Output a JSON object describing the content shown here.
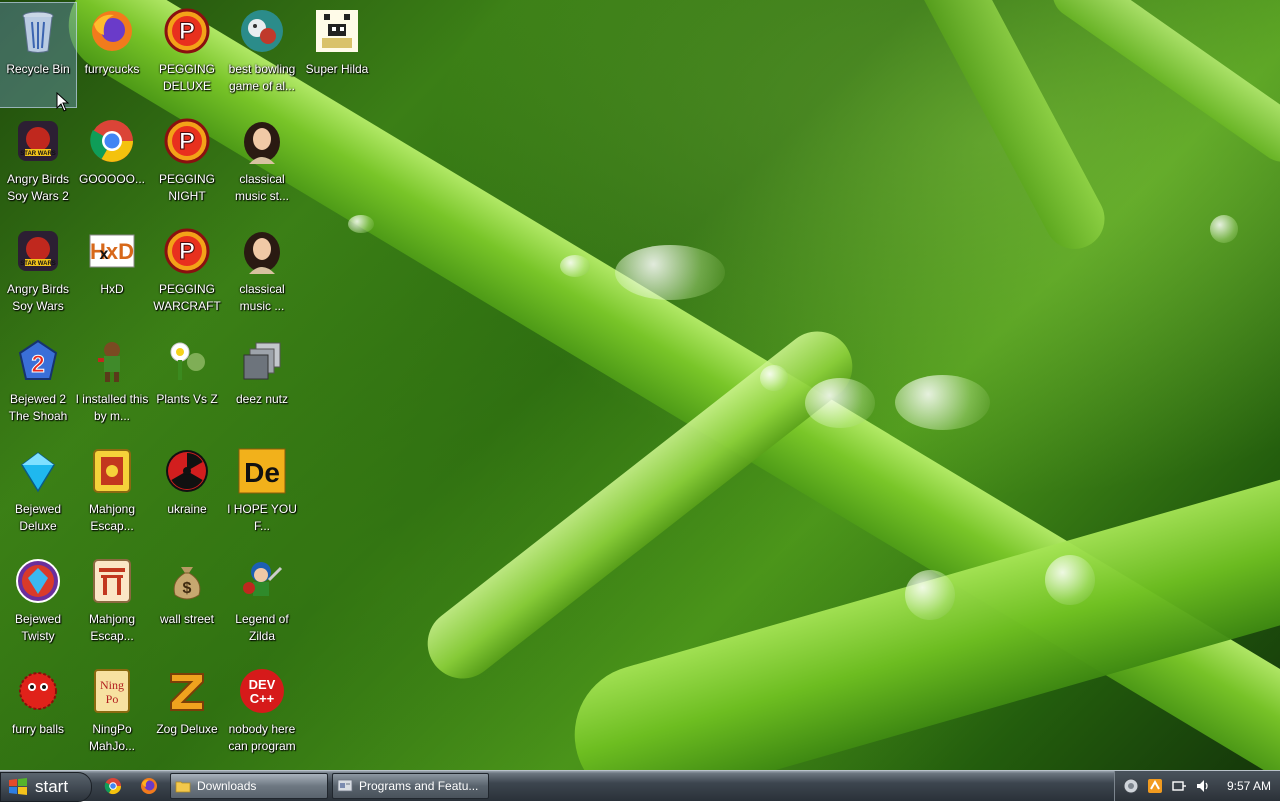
{
  "desktop": {
    "icons": [
      {
        "label": "Recycle Bin",
        "icon": "recycle-bin-icon",
        "col": 0,
        "row": 0,
        "selected": true
      },
      {
        "label": "furrycucks",
        "icon": "firefox-icon",
        "col": 1,
        "row": 0
      },
      {
        "label": "PEGGING DELUXE",
        "icon": "pegging-p-icon",
        "col": 2,
        "row": 0
      },
      {
        "label": "best bowling game of al...",
        "icon": "bowling-game-icon",
        "col": 3,
        "row": 0
      },
      {
        "label": "Super Hilda",
        "icon": "pixel-game-icon",
        "col": 4,
        "row": 0
      },
      {
        "label": "Angry Birds Soy Wars 2",
        "icon": "angry-birds-star-wars-icon",
        "col": 0,
        "row": 1
      },
      {
        "label": "GOOOOO...",
        "icon": "chrome-icon",
        "col": 1,
        "row": 1
      },
      {
        "label": "PEGGING NIGHT",
        "icon": "pegging-p-icon",
        "col": 2,
        "row": 1
      },
      {
        "label": "classical music st...",
        "icon": "classical-portrait-icon",
        "col": 3,
        "row": 1
      },
      {
        "label": "Angry Birds Soy Wars",
        "icon": "angry-birds-star-wars-icon",
        "col": 0,
        "row": 2
      },
      {
        "label": "HxD",
        "icon": "hxd-icon",
        "col": 1,
        "row": 2
      },
      {
        "label": "PEGGING WARCRAFT",
        "icon": "pegging-p-icon",
        "col": 2,
        "row": 2
      },
      {
        "label": "classical music ...",
        "icon": "classical-portrait-icon",
        "col": 3,
        "row": 2
      },
      {
        "label": "Bejewed 2 The Shoah",
        "icon": "bejeweled-2-icon",
        "col": 0,
        "row": 3
      },
      {
        "label": "I installed this by m...",
        "icon": "character-sprite-icon",
        "col": 1,
        "row": 3
      },
      {
        "label": "Plants Vs Z",
        "icon": "plants-vs-zombies-icon",
        "col": 2,
        "row": 3
      },
      {
        "label": "deez nutz",
        "icon": "stacked-windows-icon",
        "col": 3,
        "row": 3
      },
      {
        "label": "Bejewed Deluxe",
        "icon": "blue-gem-icon",
        "col": 0,
        "row": 4
      },
      {
        "label": "Mahjong Escap...",
        "icon": "mahjong-tile-icon",
        "col": 1,
        "row": 4
      },
      {
        "label": "ukraine",
        "icon": "radiation-icon",
        "col": 2,
        "row": 4
      },
      {
        "label": "I HOPE YOU F...",
        "icon": "de-badge-icon",
        "col": 3,
        "row": 4
      },
      {
        "label": "Bejewed Twisty",
        "icon": "bejeweled-twist-icon",
        "col": 0,
        "row": 5
      },
      {
        "label": "Mahjong Escap...",
        "icon": "mahjong-torii-icon",
        "col": 1,
        "row": 5
      },
      {
        "label": "wall street",
        "icon": "money-bag-icon",
        "col": 2,
        "row": 5
      },
      {
        "label": "Legend of Zilda",
        "icon": "adventure-hero-icon",
        "col": 3,
        "row": 5
      },
      {
        "label": "furry balls",
        "icon": "red-fuzzball-icon",
        "col": 0,
        "row": 6
      },
      {
        "label": "NingPo MahJo...",
        "icon": "ningpo-tile-icon",
        "col": 1,
        "row": 6
      },
      {
        "label": "Zog Deluxe",
        "icon": "zog-z-icon",
        "col": 2,
        "row": 6
      },
      {
        "label": "nobody here can program",
        "icon": "devcpp-icon",
        "col": 3,
        "row": 6
      }
    ]
  },
  "taskbar": {
    "start_label": "start",
    "quick_launch": [
      {
        "icon": "chrome-icon"
      },
      {
        "icon": "firefox-icon"
      }
    ],
    "tasks": [
      {
        "label": "Downloads",
        "icon": "folder-icon",
        "active": true
      },
      {
        "label": "Programs and Featu...",
        "icon": "programs-features-icon",
        "active": false
      }
    ],
    "tray": {
      "icons": [
        "network-globe-icon",
        "orange-app-icon",
        "safely-remove-icon",
        "volume-icon"
      ],
      "clock": "9:57 AM"
    }
  },
  "colors": {
    "accent": "#3a7f16",
    "taskbar": "#2a3139"
  }
}
